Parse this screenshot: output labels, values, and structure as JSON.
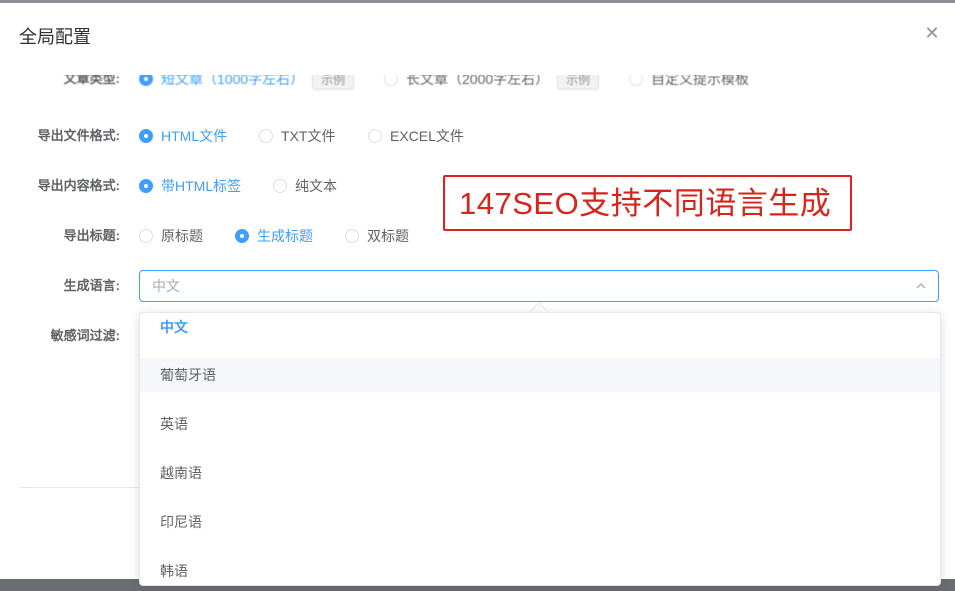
{
  "dialog": {
    "title": "全局配置",
    "close_icon": "close-icon"
  },
  "form": {
    "article_type": {
      "label": "文章类型:",
      "options": [
        {
          "label": "短文章（1000字左右）",
          "tag": "示例",
          "selected": true
        },
        {
          "label": "长文章（2000字左右）",
          "tag": "示例",
          "selected": false
        },
        {
          "label": "自定义提示模板",
          "selected": false
        }
      ]
    },
    "export_format": {
      "label": "导出文件格式:",
      "options": [
        {
          "label": "HTML文件",
          "selected": true
        },
        {
          "label": "TXT文件",
          "selected": false
        },
        {
          "label": "EXCEL文件",
          "selected": false
        }
      ]
    },
    "export_content": {
      "label": "导出内容格式:",
      "options": [
        {
          "label": "带HTML标签",
          "selected": true
        },
        {
          "label": "纯文本",
          "selected": false
        }
      ]
    },
    "export_title": {
      "label": "导出标题:",
      "options": [
        {
          "label": "原标题",
          "selected": false
        },
        {
          "label": "生成标题",
          "selected": true
        },
        {
          "label": "双标题",
          "selected": false
        }
      ]
    },
    "language": {
      "label": "生成语言:",
      "placeholder": "中文",
      "arrow_icon": "chevron-up-icon",
      "options": [
        "中文",
        "葡萄牙语",
        "英语",
        "越南语",
        "印尼语",
        "韩语"
      ],
      "selected_index": 0,
      "hover_index": 1
    },
    "sensitive_filter": {
      "label": "敏感词过滤:"
    }
  },
  "annotation": {
    "text": "147SEO支持不同语言生成",
    "color": "#d9241c"
  },
  "colors": {
    "accent": "#409eff",
    "label": "#606266"
  }
}
